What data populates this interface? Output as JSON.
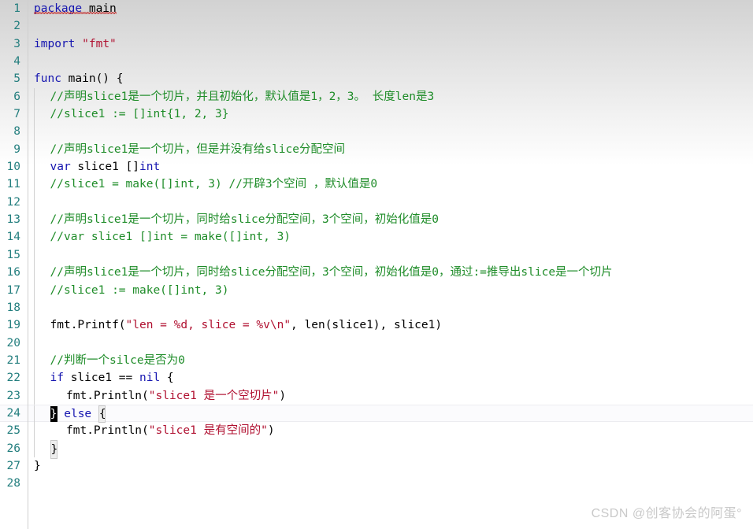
{
  "editor": {
    "language": "Go",
    "colors": {
      "background": "#ffffff",
      "line_number": "#237e7e",
      "keyword": "#1515b0",
      "string": "#b01030",
      "comment": "#1e8c28",
      "plain_text": "#000000",
      "gutter_separator": "#cfcfcf",
      "indent_guide": "#d0d0d0",
      "current_line_highlight": "#fbfbfd",
      "error_squiggle": "#c02020",
      "caret": "#000000",
      "brace_match_box": "#eeeeee",
      "watermark": "#c9c9c9"
    },
    "cursor": {
      "line": 24,
      "column": 2
    },
    "total_lines": 28,
    "lines": [
      {
        "num": "1",
        "indent": 0,
        "tokens": [
          {
            "t": "kw",
            "v": "package"
          },
          {
            "t": "pln",
            "v": " main"
          }
        ],
        "squiggle": true
      },
      {
        "num": "2",
        "indent": 0,
        "tokens": []
      },
      {
        "num": "3",
        "indent": 0,
        "tokens": [
          {
            "t": "kw",
            "v": "import"
          },
          {
            "t": "pln",
            "v": " "
          },
          {
            "t": "str",
            "v": "\"fmt\""
          }
        ]
      },
      {
        "num": "4",
        "indent": 0,
        "tokens": []
      },
      {
        "num": "5",
        "indent": 0,
        "tokens": [
          {
            "t": "kw",
            "v": "func"
          },
          {
            "t": "pln",
            "v": " main() {"
          }
        ]
      },
      {
        "num": "6",
        "indent": 1,
        "tokens": [
          {
            "t": "cmt",
            "v": "//声明slice1是一个切片，并且初始化，默认值是1，2，3。 长度len是3"
          }
        ]
      },
      {
        "num": "7",
        "indent": 1,
        "tokens": [
          {
            "t": "cmt",
            "v": "//slice1 := []int{1, 2, 3}"
          }
        ]
      },
      {
        "num": "8",
        "indent": 1,
        "tokens": []
      },
      {
        "num": "9",
        "indent": 1,
        "tokens": [
          {
            "t": "cmt",
            "v": "//声明slice1是一个切片，但是并没有给slice分配空间"
          }
        ]
      },
      {
        "num": "10",
        "indent": 1,
        "tokens": [
          {
            "t": "kw",
            "v": "var"
          },
          {
            "t": "pln",
            "v": " slice1 []"
          },
          {
            "t": "kw",
            "v": "int"
          }
        ]
      },
      {
        "num": "11",
        "indent": 1,
        "tokens": [
          {
            "t": "cmt",
            "v": "//slice1 = make([]int, 3) //开辟3个空间 ，默认值是0"
          }
        ]
      },
      {
        "num": "12",
        "indent": 1,
        "tokens": []
      },
      {
        "num": "13",
        "indent": 1,
        "tokens": [
          {
            "t": "cmt",
            "v": "//声明slice1是一个切片，同时给slice分配空间，3个空间，初始化值是0"
          }
        ]
      },
      {
        "num": "14",
        "indent": 1,
        "tokens": [
          {
            "t": "cmt",
            "v": "//var slice1 []int = make([]int, 3)"
          }
        ]
      },
      {
        "num": "15",
        "indent": 1,
        "tokens": []
      },
      {
        "num": "16",
        "indent": 1,
        "tokens": [
          {
            "t": "cmt",
            "v": "//声明slice1是一个切片，同时给slice分配空间，3个空间，初始化值是0，通过:=推导出slice是一个切片"
          }
        ]
      },
      {
        "num": "17",
        "indent": 1,
        "tokens": [
          {
            "t": "cmt",
            "v": "//slice1 := make([]int, 3)"
          }
        ]
      },
      {
        "num": "18",
        "indent": 1,
        "tokens": []
      },
      {
        "num": "19",
        "indent": 1,
        "tokens": [
          {
            "t": "pln",
            "v": "fmt.Printf("
          },
          {
            "t": "str",
            "v": "\"len = %d, slice = %v\\n\""
          },
          {
            "t": "pln",
            "v": ", len(slice1), slice1)"
          }
        ]
      },
      {
        "num": "20",
        "indent": 1,
        "tokens": []
      },
      {
        "num": "21",
        "indent": 1,
        "tokens": [
          {
            "t": "cmt",
            "v": "//判断一个silce是否为0"
          }
        ]
      },
      {
        "num": "22",
        "indent": 1,
        "tokens": [
          {
            "t": "kw",
            "v": "if"
          },
          {
            "t": "pln",
            "v": " slice1 == "
          },
          {
            "t": "kw",
            "v": "nil"
          },
          {
            "t": "pln",
            "v": " {"
          }
        ]
      },
      {
        "num": "23",
        "indent": 2,
        "tokens": [
          {
            "t": "pln",
            "v": "fmt.Println("
          },
          {
            "t": "str",
            "v": "\"slice1 是一个空切片\""
          },
          {
            "t": "pln",
            "v": ")"
          }
        ]
      },
      {
        "num": "24",
        "indent": 1,
        "current": true,
        "tokens": [
          {
            "t": "caret",
            "v": "}"
          },
          {
            "t": "pln",
            "v": " "
          },
          {
            "t": "kw",
            "v": "else"
          },
          {
            "t": "pln",
            "v": " "
          },
          {
            "t": "brace",
            "v": "{"
          }
        ]
      },
      {
        "num": "25",
        "indent": 2,
        "tokens": [
          {
            "t": "pln",
            "v": "fmt.Println("
          },
          {
            "t": "str",
            "v": "\"slice1 是有空间的\""
          },
          {
            "t": "pln",
            "v": ")"
          }
        ]
      },
      {
        "num": "26",
        "indent": 1,
        "tokens": [
          {
            "t": "brace",
            "v": "}"
          }
        ]
      },
      {
        "num": "27",
        "indent": 0,
        "tokens": [
          {
            "t": "pln",
            "v": "}"
          }
        ]
      },
      {
        "num": "28",
        "indent": 0,
        "tokens": []
      }
    ]
  },
  "watermark": {
    "text": "CSDN @创客协会的阿蛋°"
  }
}
